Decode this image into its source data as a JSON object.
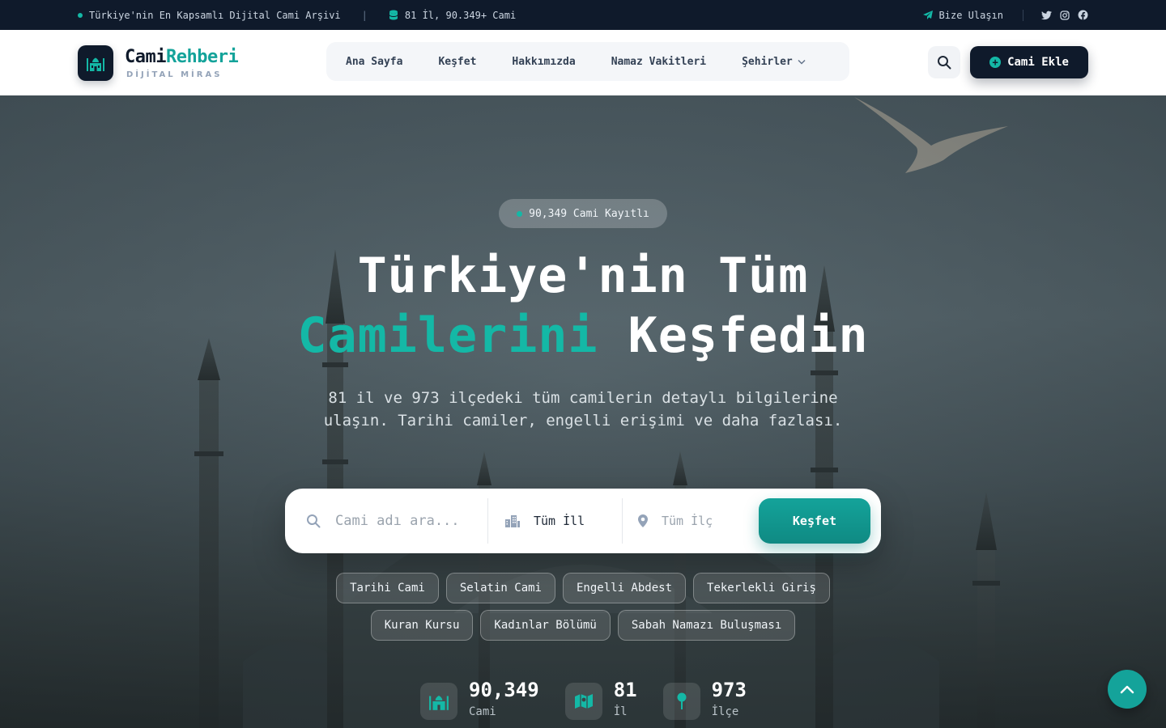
{
  "topbar": {
    "tagline": "Türkiye'nin En Kapsamlı Dijital Cami Arşivi",
    "separator": "|",
    "db_info": "81 İl, 90.349+ Cami",
    "contact": "Bize Ulaşın",
    "social": [
      "twitter-icon",
      "instagram-icon",
      "facebook-icon"
    ]
  },
  "header": {
    "logo_title_main": "Cami",
    "logo_title_accent": "Rehberi",
    "logo_subtitle": "DİJİTAL MİRAS",
    "nav": [
      "Ana Sayfa",
      "Keşfet",
      "Hakkımızda",
      "Namaz Vakitleri",
      "Şehirler"
    ],
    "add_button": "Cami Ekle"
  },
  "hero": {
    "badge": "90,349 Cami Kayıtlı",
    "title_line1": "Türkiye'nin Tüm",
    "title_accent": "Camilerini",
    "title_rest": " Keşfedin",
    "description": "81 il ve 973 ilçedeki tüm camilerin detaylı bilgilerine ulaşın. Tarihi camiler, engelli erişimi ve daha fazlası.",
    "search": {
      "name_placeholder": "Cami adı ara...",
      "il_value": "Tüm İller",
      "ilce_placeholder": "Tüm İlçeler",
      "button": "Keşfet"
    },
    "tags_row1": [
      "Tarihi Cami",
      "Selatin Cami",
      "Engelli Abdest",
      "Tekerlekli Giriş"
    ],
    "tags_row2": [
      "Kuran Kursu",
      "Kadınlar Bölümü",
      "Sabah Namazı Buluşması"
    ],
    "stats": [
      {
        "value": "90,349",
        "label": "Cami"
      },
      {
        "value": "81",
        "label": "İl"
      },
      {
        "value": "973",
        "label": "İlçe"
      }
    ]
  },
  "colors": {
    "navy": "#0f1a2b",
    "teal": "#14a39a",
    "teal_light": "#14b8a6"
  }
}
